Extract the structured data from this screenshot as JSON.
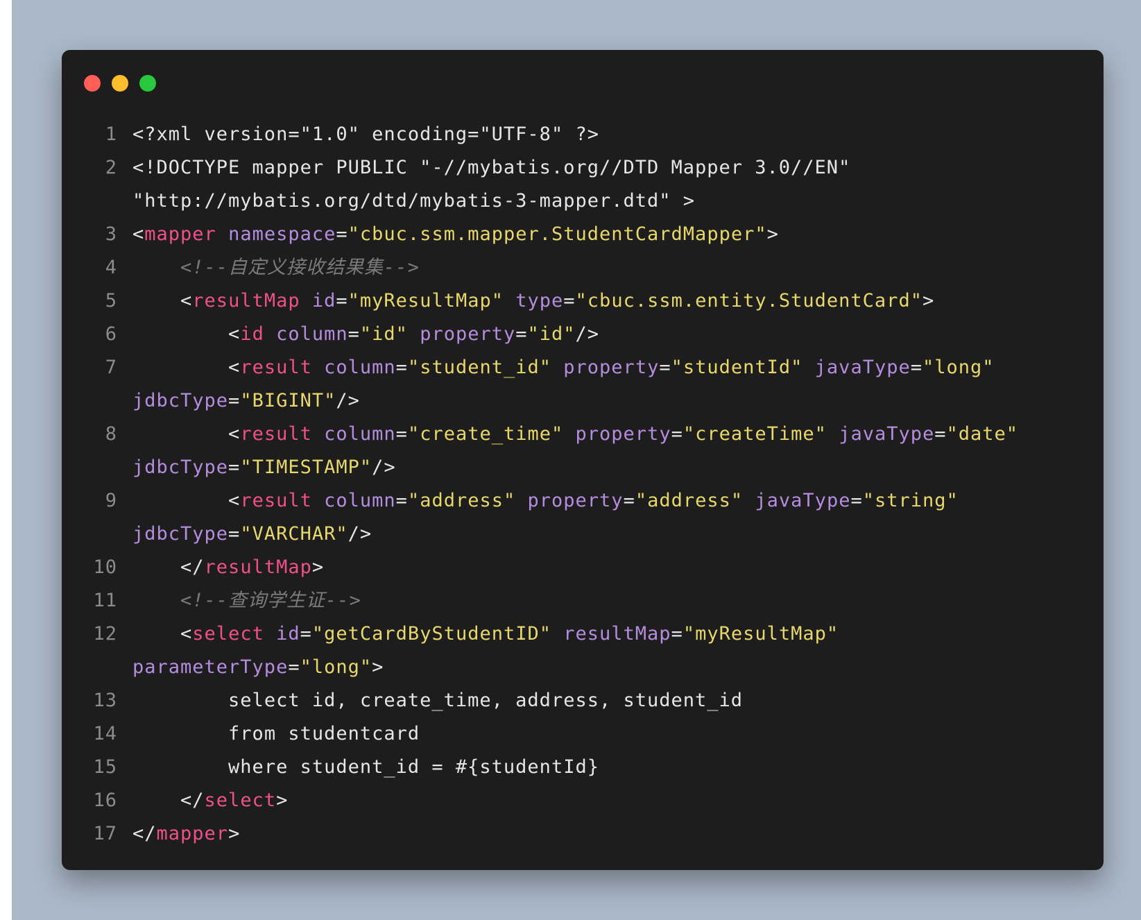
{
  "window": {
    "buttons": [
      {
        "name": "close",
        "color": "#ff5f56"
      },
      {
        "name": "minimize",
        "color": "#ffbd2e"
      },
      {
        "name": "maximize",
        "color": "#27c93f"
      }
    ]
  },
  "colors": {
    "background": "#abb8c9",
    "editor": "#1d1d1d",
    "tag": "#f0508a",
    "attribute": "#b58ce0",
    "string": "#e8d86a",
    "comment": "#7a7a7a",
    "text": "#e6e6e6",
    "line_number": "#8c8c8c"
  },
  "code": {
    "lines": [
      {
        "n": "1",
        "parts": [
          {
            "t": "<?xml version=\"1.0\" encoding=\"UTF-8\" ?>",
            "c": "t"
          }
        ]
      },
      {
        "n": "2",
        "parts": [
          {
            "t": "<!DOCTYPE mapper PUBLIC \"-//mybatis.org//DTD Mapper 3.0//EN\"",
            "c": "t"
          }
        ],
        "cont": [
          {
            "t": "\"http://mybatis.org/dtd/mybatis-3-mapper.dtd\" >",
            "c": "t"
          }
        ]
      },
      {
        "n": "3",
        "parts": [
          {
            "t": "<",
            "c": "t"
          },
          {
            "t": "mapper",
            "c": "tag"
          },
          {
            "t": " ",
            "c": "t"
          },
          {
            "t": "namespace",
            "c": "attr"
          },
          {
            "t": "=",
            "c": "t"
          },
          {
            "t": "\"cbuc.ssm.mapper.StudentCardMapper\"",
            "c": "str"
          },
          {
            "t": ">",
            "c": "t"
          }
        ]
      },
      {
        "n": "4",
        "parts": [
          {
            "t": "    <!--自定义接收结果集-->",
            "c": "cmt"
          }
        ]
      },
      {
        "n": "5",
        "parts": [
          {
            "t": "    <",
            "c": "t"
          },
          {
            "t": "resultMap",
            "c": "tag"
          },
          {
            "t": " ",
            "c": "t"
          },
          {
            "t": "id",
            "c": "attr"
          },
          {
            "t": "=",
            "c": "t"
          },
          {
            "t": "\"myResultMap\"",
            "c": "str"
          },
          {
            "t": " ",
            "c": "t"
          },
          {
            "t": "type",
            "c": "attr"
          },
          {
            "t": "=",
            "c": "t"
          },
          {
            "t": "\"cbuc.ssm.entity.StudentCard\"",
            "c": "str"
          },
          {
            "t": ">",
            "c": "t"
          }
        ]
      },
      {
        "n": "6",
        "parts": [
          {
            "t": "        <",
            "c": "t"
          },
          {
            "t": "id",
            "c": "tag"
          },
          {
            "t": " ",
            "c": "t"
          },
          {
            "t": "column",
            "c": "attr"
          },
          {
            "t": "=",
            "c": "t"
          },
          {
            "t": "\"id\"",
            "c": "str"
          },
          {
            "t": " ",
            "c": "t"
          },
          {
            "t": "property",
            "c": "attr"
          },
          {
            "t": "=",
            "c": "t"
          },
          {
            "t": "\"id\"",
            "c": "str"
          },
          {
            "t": "/>",
            "c": "t"
          }
        ]
      },
      {
        "n": "7",
        "parts": [
          {
            "t": "        <",
            "c": "t"
          },
          {
            "t": "result",
            "c": "tag"
          },
          {
            "t": " ",
            "c": "t"
          },
          {
            "t": "column",
            "c": "attr"
          },
          {
            "t": "=",
            "c": "t"
          },
          {
            "t": "\"student_id\"",
            "c": "str"
          },
          {
            "t": " ",
            "c": "t"
          },
          {
            "t": "property",
            "c": "attr"
          },
          {
            "t": "=",
            "c": "t"
          },
          {
            "t": "\"studentId\"",
            "c": "str"
          },
          {
            "t": " ",
            "c": "t"
          },
          {
            "t": "javaType",
            "c": "attr"
          },
          {
            "t": "=",
            "c": "t"
          },
          {
            "t": "\"long\"",
            "c": "str"
          }
        ],
        "cont": [
          {
            "t": "jdbcType",
            "c": "attr"
          },
          {
            "t": "=",
            "c": "t"
          },
          {
            "t": "\"BIGINT\"",
            "c": "str"
          },
          {
            "t": "/>",
            "c": "t"
          }
        ]
      },
      {
        "n": "8",
        "parts": [
          {
            "t": "        <",
            "c": "t"
          },
          {
            "t": "result",
            "c": "tag"
          },
          {
            "t": " ",
            "c": "t"
          },
          {
            "t": "column",
            "c": "attr"
          },
          {
            "t": "=",
            "c": "t"
          },
          {
            "t": "\"create_time\"",
            "c": "str"
          },
          {
            "t": " ",
            "c": "t"
          },
          {
            "t": "property",
            "c": "attr"
          },
          {
            "t": "=",
            "c": "t"
          },
          {
            "t": "\"createTime\"",
            "c": "str"
          },
          {
            "t": " ",
            "c": "t"
          },
          {
            "t": "javaType",
            "c": "attr"
          },
          {
            "t": "=",
            "c": "t"
          },
          {
            "t": "\"date\"",
            "c": "str"
          }
        ],
        "cont": [
          {
            "t": "jdbcType",
            "c": "attr"
          },
          {
            "t": "=",
            "c": "t"
          },
          {
            "t": "\"TIMESTAMP\"",
            "c": "str"
          },
          {
            "t": "/>",
            "c": "t"
          }
        ]
      },
      {
        "n": "9",
        "parts": [
          {
            "t": "        <",
            "c": "t"
          },
          {
            "t": "result",
            "c": "tag"
          },
          {
            "t": " ",
            "c": "t"
          },
          {
            "t": "column",
            "c": "attr"
          },
          {
            "t": "=",
            "c": "t"
          },
          {
            "t": "\"address\"",
            "c": "str"
          },
          {
            "t": " ",
            "c": "t"
          },
          {
            "t": "property",
            "c": "attr"
          },
          {
            "t": "=",
            "c": "t"
          },
          {
            "t": "\"address\"",
            "c": "str"
          },
          {
            "t": " ",
            "c": "t"
          },
          {
            "t": "javaType",
            "c": "attr"
          },
          {
            "t": "=",
            "c": "t"
          },
          {
            "t": "\"string\"",
            "c": "str"
          }
        ],
        "cont": [
          {
            "t": "jdbcType",
            "c": "attr"
          },
          {
            "t": "=",
            "c": "t"
          },
          {
            "t": "\"VARCHAR\"",
            "c": "str"
          },
          {
            "t": "/>",
            "c": "t"
          }
        ]
      },
      {
        "n": "10",
        "parts": [
          {
            "t": "    </",
            "c": "t"
          },
          {
            "t": "resultMap",
            "c": "tag"
          },
          {
            "t": ">",
            "c": "t"
          }
        ]
      },
      {
        "n": "11",
        "parts": [
          {
            "t": "    <!--查询学生证-->",
            "c": "cmt"
          }
        ]
      },
      {
        "n": "12",
        "parts": [
          {
            "t": "    <",
            "c": "t"
          },
          {
            "t": "select",
            "c": "tag"
          },
          {
            "t": " ",
            "c": "t"
          },
          {
            "t": "id",
            "c": "attr"
          },
          {
            "t": "=",
            "c": "t"
          },
          {
            "t": "\"getCardByStudentID\"",
            "c": "str"
          },
          {
            "t": " ",
            "c": "t"
          },
          {
            "t": "resultMap",
            "c": "attr"
          },
          {
            "t": "=",
            "c": "t"
          },
          {
            "t": "\"myResultMap\"",
            "c": "str"
          }
        ],
        "cont": [
          {
            "t": "parameterType",
            "c": "attr"
          },
          {
            "t": "=",
            "c": "t"
          },
          {
            "t": "\"long\"",
            "c": "str"
          },
          {
            "t": ">",
            "c": "t"
          }
        ]
      },
      {
        "n": "13",
        "parts": [
          {
            "t": "        select id, create_time, address, student_id",
            "c": "t"
          }
        ]
      },
      {
        "n": "14",
        "parts": [
          {
            "t": "        from studentcard",
            "c": "t"
          }
        ]
      },
      {
        "n": "15",
        "parts": [
          {
            "t": "        where student_id = #{studentId}",
            "c": "t"
          }
        ]
      },
      {
        "n": "16",
        "parts": [
          {
            "t": "    </",
            "c": "t"
          },
          {
            "t": "select",
            "c": "tag"
          },
          {
            "t": ">",
            "c": "t"
          }
        ]
      },
      {
        "n": "17",
        "parts": [
          {
            "t": "</",
            "c": "t"
          },
          {
            "t": "mapper",
            "c": "tag"
          },
          {
            "t": ">",
            "c": "t"
          }
        ]
      }
    ]
  }
}
